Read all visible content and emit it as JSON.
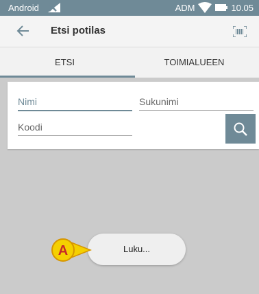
{
  "status_bar": {
    "carrier": "Android",
    "operator": "ADM",
    "time": "10.05"
  },
  "app_bar": {
    "title": "Etsi potilas"
  },
  "tabs": [
    {
      "label": "ETSI",
      "selected": true
    },
    {
      "label": "TOIMIALUEEN",
      "selected": false
    }
  ],
  "search": {
    "name_placeholder": "Nimi",
    "surname_placeholder": "Sukunimi",
    "code_placeholder": "Koodi"
  },
  "loading": {
    "text": "Luku...",
    "callout_letter": "A"
  },
  "colors": {
    "accent": "#6f8a97",
    "callout_fill": "#f5d000",
    "callout_text": "#c62828",
    "overlay": "#cbcbcb"
  }
}
